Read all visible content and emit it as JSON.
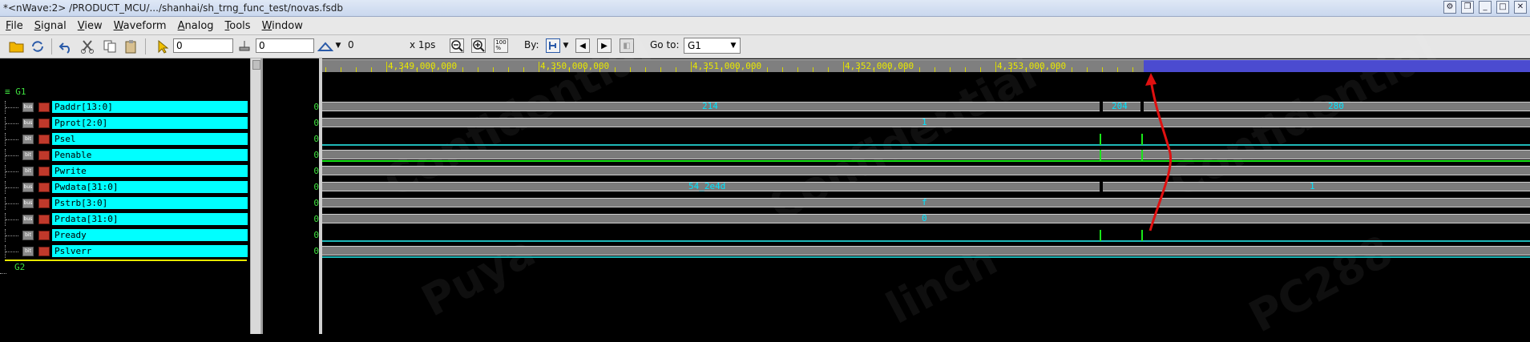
{
  "window": {
    "title": "*<nWave:2> /PRODUCT_MCU/.../shanhai/sh_trng_func_test/novas.fsdb"
  },
  "menu": {
    "items": [
      {
        "label": "File",
        "mnemonic": "F",
        "rest": "ile"
      },
      {
        "label": "Signal",
        "mnemonic": "S",
        "rest": "ignal"
      },
      {
        "label": "View",
        "mnemonic": "V",
        "rest": "iew"
      },
      {
        "label": "Waveform",
        "mnemonic": "W",
        "rest": "aveform"
      },
      {
        "label": "Analog",
        "mnemonic": "A",
        "rest": "nalog"
      },
      {
        "label": "Tools",
        "mnemonic": "T",
        "rest": "ools"
      },
      {
        "label": "Window",
        "mnemonic": "W",
        "rest": "indow"
      }
    ]
  },
  "toolbar": {
    "cursor_time": "0",
    "marker_time": "0",
    "delta_value": "0",
    "time_unit": "x 1ps",
    "by_label": "By:",
    "goto_label": "Go to:",
    "goto_value": "G1"
  },
  "signals": {
    "group1": "≡ G1",
    "group2": "G2",
    "rows": [
      {
        "name": "Paddr[13:0]",
        "value": "0"
      },
      {
        "name": "Pprot[2:0]",
        "value": "0"
      },
      {
        "name": "Psel",
        "value": "0"
      },
      {
        "name": "Penable",
        "value": "0"
      },
      {
        "name": "Pwrite",
        "value": "0"
      },
      {
        "name": "Pwdata[31:0]",
        "value": "0"
      },
      {
        "name": "Pstrb[3:0]",
        "value": "0"
      },
      {
        "name": "Prdata[31:0]",
        "value": "0"
      },
      {
        "name": "Pready",
        "value": "0"
      },
      {
        "name": "Pslverr",
        "value": "0"
      }
    ]
  },
  "ruler": {
    "labels": [
      "4,349,000,000",
      "4,350,000,000",
      "4,351,000,000",
      "4,352,000,000",
      "4,353,000,000"
    ]
  },
  "waves": {
    "paddr": [
      "214",
      "204",
      "280"
    ],
    "pprot": "1",
    "pwdata": [
      "54_2e4d",
      "1"
    ],
    "pstrb": "f",
    "prdata": "0"
  },
  "watermark": [
    "Confidential",
    "Puya",
    "linch",
    "PC288"
  ],
  "colors": {
    "signal_bg": "#00ffff",
    "group_text": "#3fe13f",
    "bus_text": "#00e5ff",
    "ruler_text": "#e8e800",
    "annotation": "#e01010"
  }
}
